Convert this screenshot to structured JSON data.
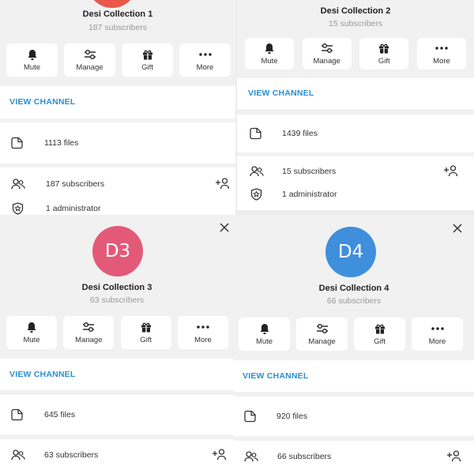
{
  "panels": [
    {
      "channel_name": "Desi Collection 1",
      "subscribers_text": "187 subscribers",
      "actions": [
        "Mute",
        "Manage",
        "Gift",
        "More"
      ],
      "view_channel": "VIEW CHANNEL",
      "files": "1113 files",
      "subscribers_row": "187 subscribers",
      "administrators": "1 administrator",
      "avatar_color": "#e8574a"
    },
    {
      "channel_name": "Desi Collection 2",
      "subscribers_text": "15 subscribers",
      "actions": [
        "Mute",
        "Manage",
        "Gift",
        "More"
      ],
      "view_channel": "VIEW CHANNEL",
      "files": "1439 files",
      "subscribers_row": "15 subscribers",
      "administrators": "1 administrator"
    },
    {
      "channel_name": "Desi Collection 3",
      "subscribers_text": "63 subscribers",
      "avatar_text": "D3",
      "avatar_color": "#e35a78",
      "actions": [
        "Mute",
        "Manage",
        "Gift",
        "More"
      ],
      "view_channel": "VIEW CHANNEL",
      "files": "645 files",
      "subscribers_row": "63 subscribers"
    },
    {
      "channel_name": "Desi Collection 4",
      "subscribers_text": "66 subscribers",
      "avatar_text": "D4",
      "avatar_color": "#3f8fdc",
      "actions": [
        "Mute",
        "Manage",
        "Gift",
        "More"
      ],
      "view_channel": "VIEW CHANNEL",
      "files": "920 files",
      "subscribers_row": "66 subscribers"
    }
  ],
  "icons": {
    "mute": "bell-icon",
    "manage": "sliders-icon",
    "gift": "gift-icon",
    "more": "more-dots-icon",
    "files": "file-icon",
    "subscribers": "people-icon",
    "add_member": "add-person-icon",
    "administrators": "shield-star-icon",
    "close": "close-icon"
  },
  "colors": {
    "accent": "#2a8fd1",
    "background": "#f1f1f1",
    "card": "#ffffff"
  }
}
